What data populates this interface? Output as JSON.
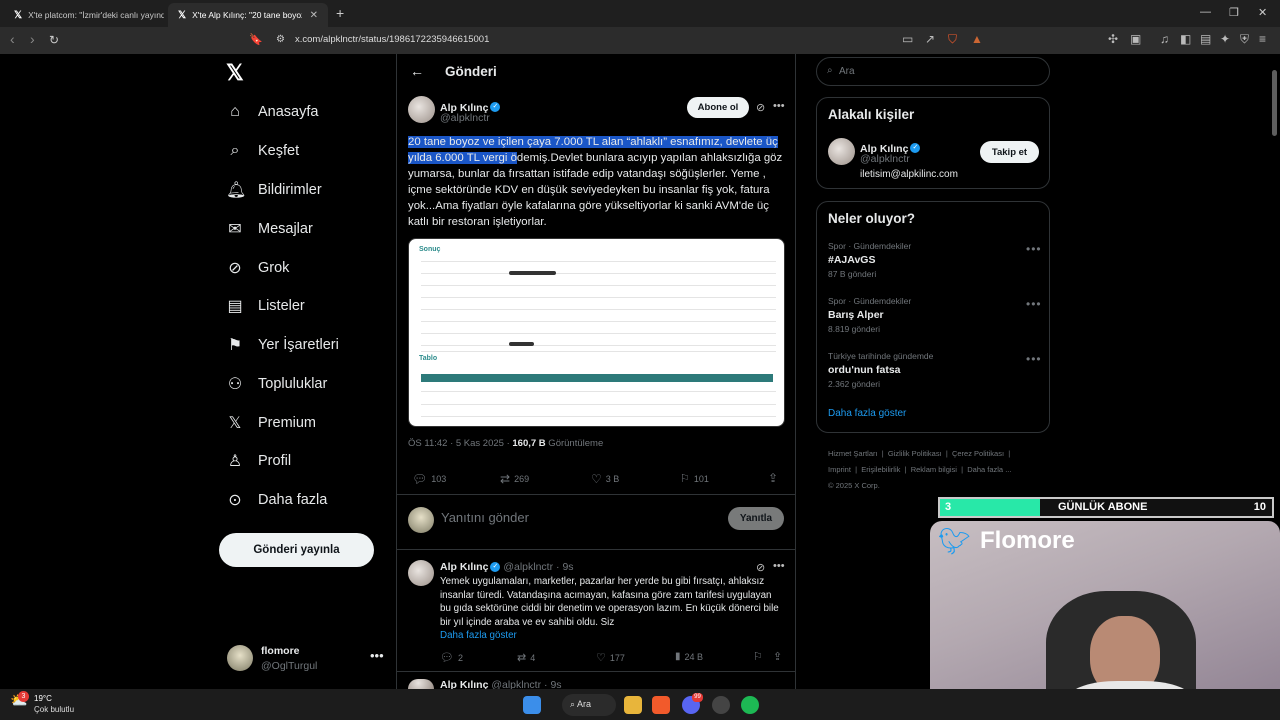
{
  "browser": {
    "tabs": [
      {
        "label": "X'te platcom: \"İzmir'deki canlı yayınd..."
      },
      {
        "label": "X'te Alp Kılınç: \"20 tane boyoz ve..."
      }
    ],
    "url": "x.com/alpklnctr/status/1986172235946615001",
    "new_tab_glyph": "+"
  },
  "sidebar": {
    "items": [
      {
        "label": "Anasayfa",
        "icon": "home-icon"
      },
      {
        "label": "Keşfet",
        "icon": "search-icon"
      },
      {
        "label": "Bildirimler",
        "icon": "bell-icon"
      },
      {
        "label": "Mesajlar",
        "icon": "mail-icon"
      },
      {
        "label": "Grok",
        "icon": "grok-icon"
      },
      {
        "label": "Listeler",
        "icon": "list-icon"
      },
      {
        "label": "Yer İşaretleri",
        "icon": "bookmark-icon"
      },
      {
        "label": "Topluluklar",
        "icon": "community-icon"
      },
      {
        "label": "Premium",
        "icon": "x-icon"
      },
      {
        "label": "Profil",
        "icon": "profile-icon"
      },
      {
        "label": "Daha fazla",
        "icon": "more-icon"
      }
    ],
    "post_button": "Gönderi yayınla",
    "account": {
      "name": "flomore",
      "handle": "@OglTurgul"
    }
  },
  "post": {
    "header": "Gönderi",
    "author": {
      "name": "Alp Kılınç",
      "handle": "@alpklnctr"
    },
    "subscribe_label": "Abone ol",
    "text_highlighted": "20 tane boyoz ve içilen çaya 7.000 TL alan “ahlaklı” esnafımız, devlete üç yılda 6.000 TL vergi ö",
    "text_rest": "demiş.Devlet bunlara acıyıp yapılan ahlaksızlığa göz yumarsa, bunlar da fırsattan istifade edip vatandaşı söğüşlerler. Yeme , içme sektöründe KDV en düşük seviyedeyken bu insanlar fiş yok, fatura yok...Ama fiyatları öyle kafalarına göre yükseltiyorlar ki sanki AVM'de üç katlı bir restoran işletiyorlar.",
    "media": {
      "section1": "Sonuç",
      "section2": "Tablo"
    },
    "time": "ÖS 11:42 · 5 Kas 2025 · ",
    "views": "160,7 B",
    "views_label": " Görüntüleme",
    "stats": {
      "replies": "103",
      "reposts": "269",
      "likes": "3 B",
      "bookmarks": "101"
    },
    "reply_placeholder": "Yanıtını gönder",
    "reply_button": "Yanıtla"
  },
  "reply": {
    "name": "Alp Kılınç",
    "handle": "@alpklnctr",
    "time": "· 9s",
    "text": "Yemek uygulamaları, marketler, pazarlar her yerde bu gibi fırsatçı, ahlaksız insanlar türedi. Vatandaşına acımayan, kafasına göre zam tarifesi uygulayan bu gıda sektörüne ciddi bir denetim ve operasyon lazım. En küçük dönerci bile bir yıl içinde araba ve ev sahibi oldu. Siz",
    "show_more": "Daha fazla göster",
    "stats": {
      "replies": "2",
      "reposts": "4",
      "likes": "177",
      "views": "24 B"
    }
  },
  "reply2": {
    "name": "Alp Kılınç",
    "handle": "@alpklnctr",
    "time": "· 9s"
  },
  "right": {
    "search_placeholder": "Ara",
    "related_title": "Alakalı kişiler",
    "related_person": {
      "name": "Alp Kılınç",
      "handle": "@alpklnctr",
      "bio": "iletisim@alpkilinc.com",
      "follow": "Takip et"
    },
    "trends_title": "Neler oluyor?",
    "trends": [
      {
        "category": "Spor · Gündemdekiler",
        "title": "#AJAvGS",
        "count": "87 B gönderi"
      },
      {
        "category": "Spor · Gündemdekiler",
        "title": "Barış Alper",
        "count": "8.819 gönderi"
      },
      {
        "category": "Türkiye tarihinde gündemde",
        "title": "ordu'nun fatsa",
        "count": "2.362 gönderi"
      }
    ],
    "show_more": "Daha fazla göster",
    "footer": [
      "Hizmet Şartları",
      "Gizlilik Politikası",
      "Çerez Politikası",
      "Imprint",
      "Erişilebilirlik",
      "Reklam bilgisi",
      "Daha fazla ...",
      "© 2025 X Corp."
    ]
  },
  "overlay": {
    "goal_current": "3",
    "goal_label": "GÜNLÜK ABONE",
    "goal_target": "10",
    "goal_progress": 0.3,
    "streamer": "Flomore"
  },
  "taskbar": {
    "weather_temp": "19°C",
    "weather_desc": "Çok bulutlu",
    "search": "Ara",
    "weather_badge": "3",
    "discord_badge": "99"
  },
  "colors": {
    "accent": "#1d9bf0",
    "goal_fill": "#28e8a8",
    "highlight": "#1a56c7"
  }
}
